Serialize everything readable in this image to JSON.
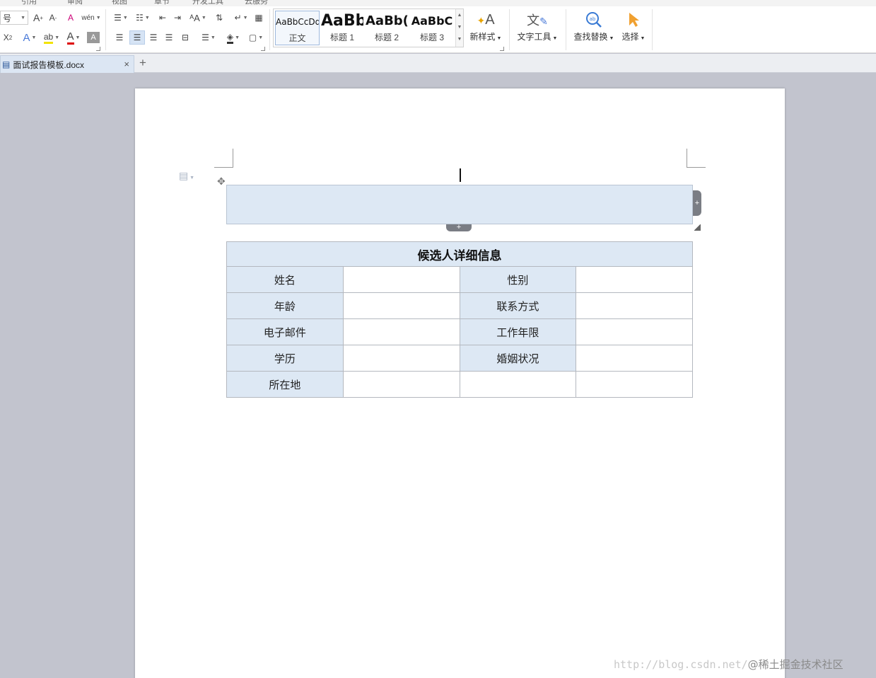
{
  "menu": [
    "引用",
    "审阅",
    "视图",
    "章节",
    "开发工具",
    "云服务"
  ],
  "font": {
    "size_fragment": "号"
  },
  "styles": [
    {
      "sample": "AaBbCcDd",
      "name": "正文"
    },
    {
      "sample": "AaBb",
      "name": "标题 1"
    },
    {
      "sample": "AaBb(",
      "name": "标题 2"
    },
    {
      "sample": "AaBbC",
      "name": "标题 3"
    }
  ],
  "tools": {
    "new_style": "新样式",
    "text_tools": "文字工具",
    "find_replace": "查找替换",
    "select": "选择"
  },
  "tab": {
    "filename": "面试报告模板.docx"
  },
  "table": {
    "title": "候选人详细信息",
    "rows": [
      [
        "姓名",
        "",
        "性别",
        ""
      ],
      [
        "年龄",
        "",
        "联系方式",
        ""
      ],
      [
        "电子邮件",
        "",
        "工作年限",
        ""
      ],
      [
        "学历",
        "",
        "婚姻状况",
        ""
      ],
      [
        "所在地",
        "",
        "",
        ""
      ]
    ]
  },
  "watermark": {
    "url": "http://blog.csdn.net/",
    "site": "@稀土掘金技术社区"
  },
  "colors": {
    "cell_fill": "#dde8f4",
    "page_bg": "#c2c4ce",
    "accent": "#2b579a"
  }
}
